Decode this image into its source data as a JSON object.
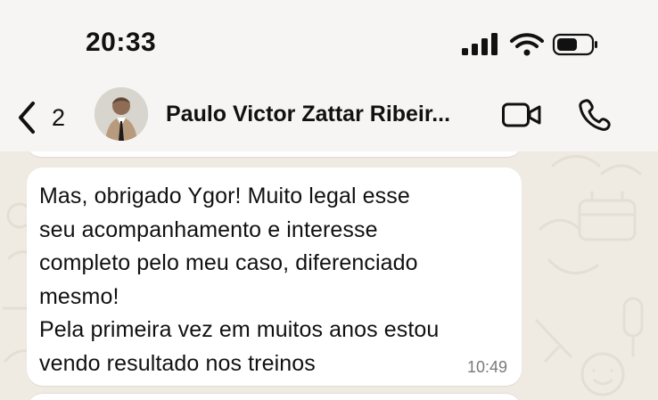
{
  "status_bar": {
    "time": "20:33",
    "signal_icon": "cellular-signal-icon",
    "wifi_icon": "wifi-icon",
    "battery_icon": "battery-icon"
  },
  "header": {
    "back_icon": "chevron-left-icon",
    "back_count": "2",
    "avatar_icon": "contact-avatar",
    "contact_name": "Paulo Victor Zattar Ribeir...",
    "video_icon": "video-call-icon",
    "call_icon": "phone-call-icon"
  },
  "message": {
    "lines": [
      "Mas, obrigado Ygor! Muito legal esse",
      "seu acompanhamento e interesse",
      "completo pelo meu caso, diferenciado",
      "mesmo!",
      "Pela primeira vez em muitos anos estou",
      "vendo resultado nos treinos"
    ],
    "time": "10:49"
  },
  "colors": {
    "chat_background": "#efeae2",
    "header_background": "#f6f5f3",
    "bubble_background": "#ffffff",
    "time_text": "#7a7a7a"
  }
}
